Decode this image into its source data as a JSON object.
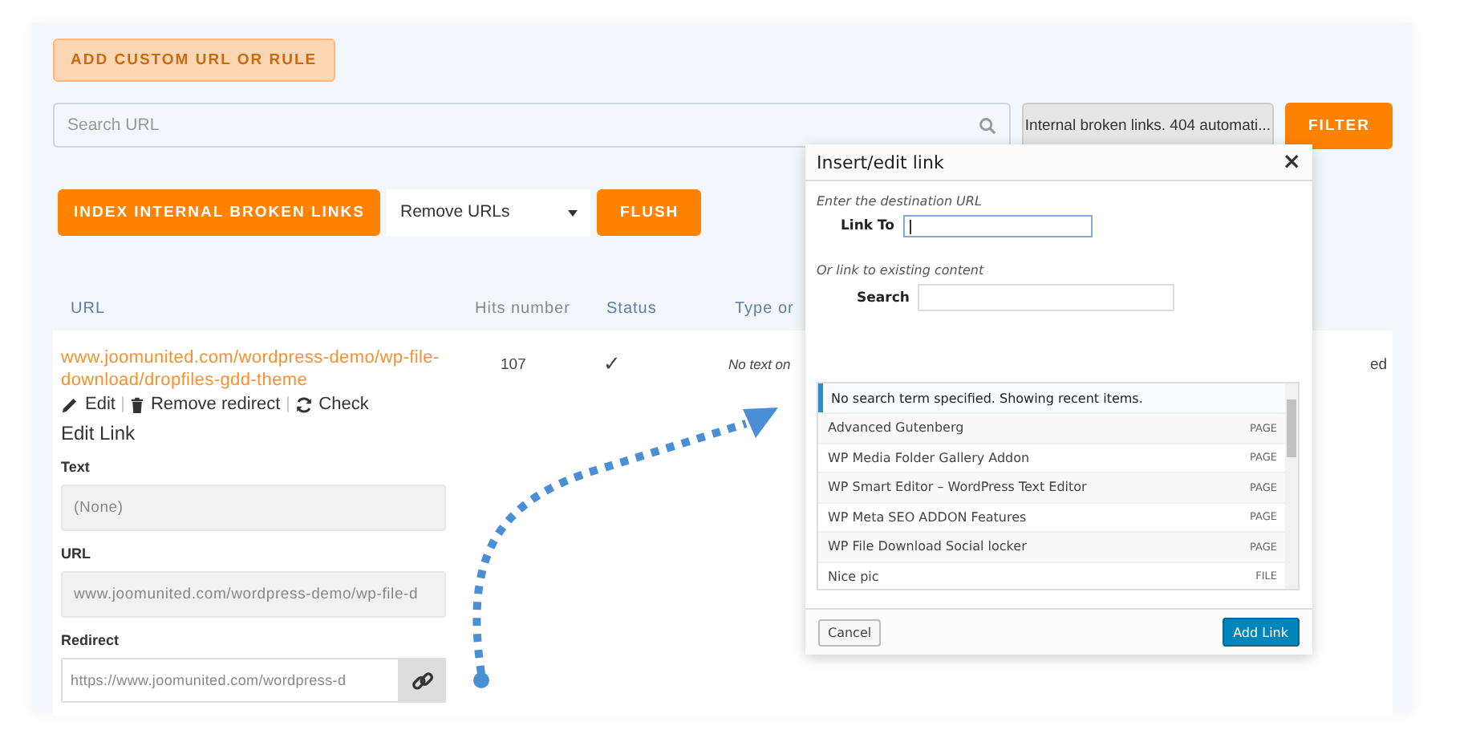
{
  "add_button": {
    "label": "ADD CUSTOM URL OR RULE",
    "disabled": true
  },
  "search": {
    "placeholder": "Search URL"
  },
  "filter_select": {
    "value": "Internal broken links. 404 automati..."
  },
  "filter_button": "FILTER",
  "index_button": "INDEX INTERNAL BROKEN LINKS",
  "action_select": {
    "value": "Remove URLs"
  },
  "flush_button": "FLUSH",
  "table": {
    "columns": [
      "URL",
      "Hits number",
      "Status",
      "Type or"
    ],
    "rows": [
      {
        "url": "www.joomunited.com/wordpress-demo/wp-file-download/dropfiles-gdd-theme",
        "actions": [
          {
            "kind": "edit",
            "label": "Edit"
          },
          {
            "kind": "remove",
            "label": "Remove redirect"
          },
          {
            "kind": "check",
            "label": "Check"
          }
        ],
        "hits": "107",
        "status": "✓",
        "type": "No text on",
        "column_5": "ed"
      }
    ]
  },
  "edit_link": {
    "title": "Edit Link",
    "fields": [
      {
        "label": "Text",
        "value": "(None)",
        "kind": "readonly"
      },
      {
        "label": "URL",
        "value": "www.joomunited.com/wordpress-demo/wp-file-d",
        "kind": "readonly"
      },
      {
        "label": "Redirect",
        "value": "https://www.joomunited.com/wordpress-d",
        "kind": "link"
      }
    ]
  },
  "dialog": {
    "title": "Insert/edit link",
    "close": "×",
    "dest_hint": "Enter the destination URL",
    "link_to_label": "Link To",
    "existing_hint": "Or link to existing content",
    "search_label": "Search",
    "notice": "No search term specified. Showing recent items.",
    "items": [
      {
        "title": "Advanced Gutenberg",
        "type": "PAGE"
      },
      {
        "title": "WP Media Folder Gallery Addon",
        "type": "PAGE"
      },
      {
        "title": "WP Smart Editor – WordPress Text Editor",
        "type": "PAGE"
      },
      {
        "title": "WP Meta SEO ADDON Features",
        "type": "PAGE"
      },
      {
        "title": "WP File Download Social locker",
        "type": "PAGE"
      },
      {
        "title": "Nice pic",
        "type": "FILE"
      }
    ],
    "cancel_button": "Cancel",
    "add_button": "Add Link"
  }
}
